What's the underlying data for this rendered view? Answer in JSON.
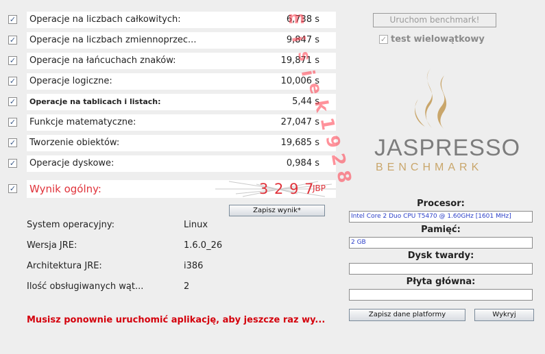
{
  "tests": [
    {
      "label": "Operacje na liczbach całkowitych:",
      "value": "6,738 s",
      "checked": true
    },
    {
      "label": "Operacje na liczbach zmiennoprzec...",
      "value": "9,847 s",
      "checked": true
    },
    {
      "label": "Operacje na łańcuchach znaków:",
      "value": "19,871 s",
      "checked": true
    },
    {
      "label": "Operacje logiczne:",
      "value": "10,006 s",
      "checked": true
    },
    {
      "label": "Operacje na tablicach i listach:",
      "value": "5,44 s",
      "checked": true
    },
    {
      "label": "Funkcje matematyczne:",
      "value": "27,047 s",
      "checked": true
    },
    {
      "label": "Tworzenie obiektów:",
      "value": "19,685 s",
      "checked": true
    },
    {
      "label": "Operacje dyskowe:",
      "value": "0,984 s",
      "checked": true
    }
  ],
  "score": {
    "label": "Wynik ogólny:",
    "value": "3 2 9 7",
    "unit": "JBP"
  },
  "checkbox_glyph": "✓",
  "buttons": {
    "run": "Uruchom benchmark!",
    "save_result": "Zapisz wynik*",
    "save_platform": "Zapisz dane platformy",
    "detect": "Wykryj"
  },
  "multithread_label": "test wielowątkowy",
  "logo": {
    "title": "JASPRESSO",
    "subtitle": "BENCHMARK",
    "color_gold": "#c9a66b",
    "color_gray": "#7d7d7d"
  },
  "system": [
    {
      "label": "System operacyjny:",
      "value": "Linux"
    },
    {
      "label": "Wersja JRE:",
      "value": "1.6.0_26"
    },
    {
      "label": "Architektura JRE:",
      "value": "i386"
    },
    {
      "label": "Ilość obsługiwanych wąt...",
      "value": "2"
    }
  ],
  "platform": {
    "cpu_label": "Procesor:",
    "cpu_value": "Intel Core 2 Duo CPU     T5470  @ 1.60GHz [1601 MHz]",
    "ram_label": "Pamięć:",
    "ram_value": "2 GB",
    "disk_label": "Dysk twardy:",
    "disk_value": "",
    "board_label": "Płyta główna:",
    "board_value": ""
  },
  "warning": "Musisz ponownie uruchomić aplikację, aby jeszcze raz wy...",
  "watermark": "misiek1928",
  "colors": {
    "warning": "#d4000c",
    "score": "#e0323a",
    "field_text": "#2a3ec8"
  }
}
